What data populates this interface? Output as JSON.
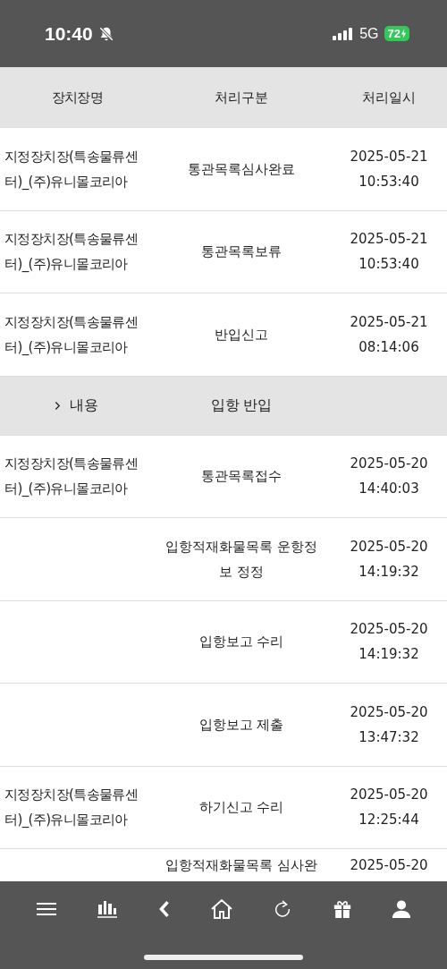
{
  "status_bar": {
    "time": "10:40",
    "network": "5G",
    "battery": "72"
  },
  "table": {
    "columns": [
      "장치장명",
      "처리구분",
      "처리일시"
    ],
    "rows": [
      {
        "kind": "record",
        "place": "지정장치장(특송물류센터)_(주)유니몰코리아",
        "action": "통관목록심사완료",
        "date": "2025-05-21",
        "time": "10:53:40"
      },
      {
        "kind": "record",
        "place": "지정장치장(특송물류센터)_(주)유니몰코리아",
        "action": "통관목록보류",
        "date": "2025-05-21",
        "time": "10:53:40"
      },
      {
        "kind": "record",
        "place": "지정장치장(특송물류센터)_(주)유니몰코리아",
        "action": "반입신고",
        "date": "2025-05-21",
        "time": "08:14:06"
      },
      {
        "kind": "section",
        "label": "내용",
        "value": "입항 반입",
        "expanded": false
      },
      {
        "kind": "record",
        "place": "지정장치장(특송물류센터)_(주)유니몰코리아",
        "action": "통관목록접수",
        "date": "2025-05-20",
        "time": "14:40:03"
      },
      {
        "kind": "record",
        "action": "입항적재화물목록 운항정보 정정",
        "date": "2025-05-20",
        "time": "14:19:32"
      },
      {
        "kind": "record",
        "action": "입항보고 수리",
        "date": "2025-05-20",
        "time": "14:19:32"
      },
      {
        "kind": "record",
        "action": "입항보고 제출",
        "date": "2025-05-20",
        "time": "13:47:32"
      },
      {
        "kind": "record",
        "place": "지정장치장(특송물류센터)_(주)유니몰코리아",
        "action": "하기신고 수리",
        "date": "2025-05-20",
        "time": "12:25:44"
      },
      {
        "kind": "partial",
        "action": "입항적재화물목록 심사완",
        "date": "2025-05-20"
      }
    ]
  }
}
